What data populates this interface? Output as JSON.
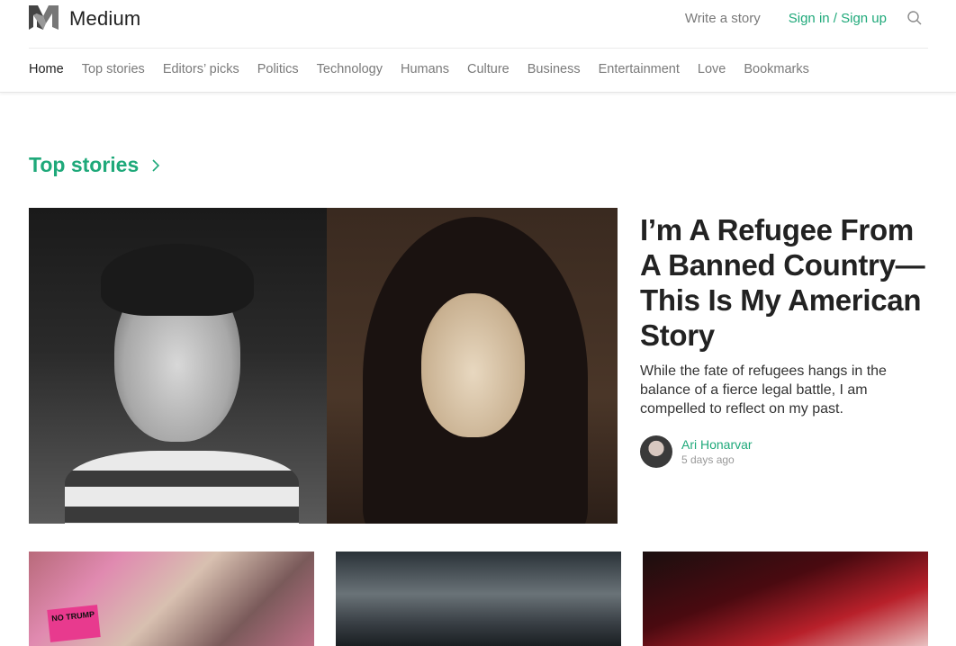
{
  "header": {
    "logo_text": "Medium",
    "write_story": "Write a story",
    "sign_in": "Sign in / Sign up"
  },
  "nav": {
    "items": [
      "Home",
      "Top stories",
      "Editors’ picks",
      "Politics",
      "Technology",
      "Humans",
      "Culture",
      "Business",
      "Entertainment",
      "Love",
      "Bookmarks"
    ],
    "active": "Home"
  },
  "section": {
    "title": "Top stories"
  },
  "featured": {
    "headline": "I’m A Refugee From A Banned Country—This Is My American Story",
    "subtitle": "While the fate of refugees hangs in the balance of a fierce legal battle, I am compelled to reflect on my past.",
    "author": "Ari Honarvar",
    "time": "5 days ago"
  },
  "thumbnails": {
    "sign_text": "NO TRUMP"
  },
  "colors": {
    "accent": "#1fa97a",
    "nav_text": "#7a7a7a",
    "headline": "#222222"
  },
  "icons": [
    "medium-logo-icon",
    "search-icon",
    "chevron-right-icon"
  ]
}
